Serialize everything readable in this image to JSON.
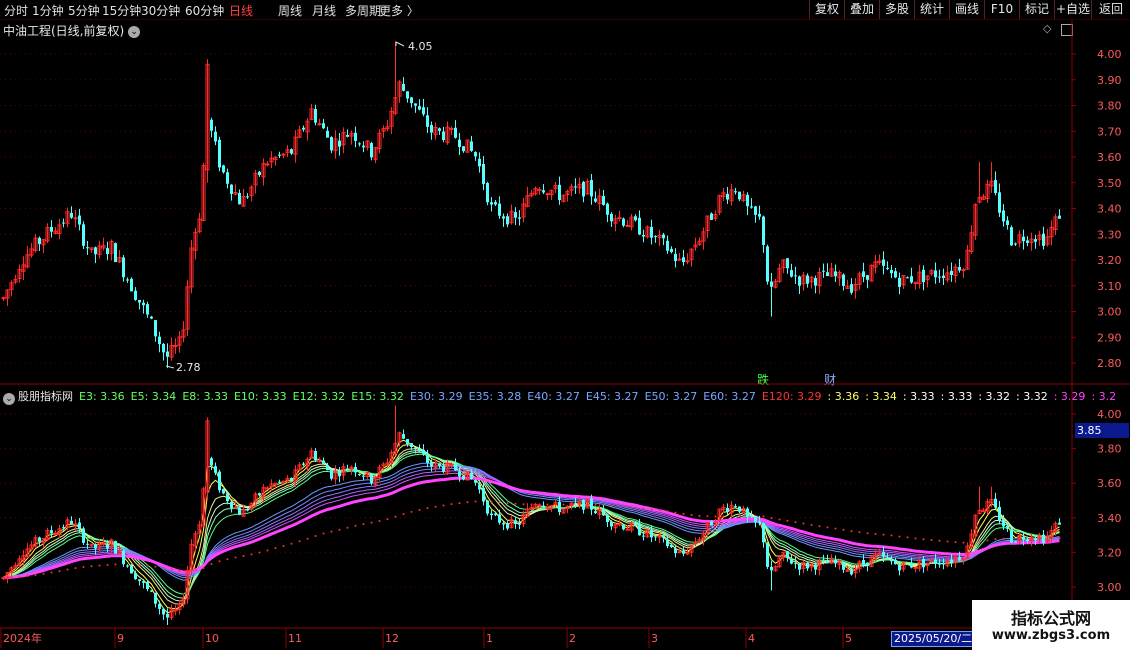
{
  "toolbar": {
    "periods": [
      "分时",
      "1分钟",
      "5分钟",
      "15分钟",
      "30分钟",
      "60分钟",
      "日线",
      "周线",
      "月线",
      "多周期",
      "更多 〉"
    ],
    "active_period": "日线",
    "right_buttons": [
      "复权",
      "叠加",
      "多股",
      "统计",
      "画线",
      "F10",
      "标记",
      "+自选",
      "返回"
    ]
  },
  "main_chart": {
    "title": "中油工程(日线,前复权)",
    "y_ticks": [
      "4.00",
      "3.90",
      "3.80",
      "3.70",
      "3.60",
      "3.50",
      "3.40",
      "3.30",
      "3.20",
      "3.10",
      "3.00",
      "2.90",
      "2.80"
    ],
    "high_label": "4.05",
    "low_label": "2.78"
  },
  "indicator": {
    "name": "股朋指标网",
    "legend": [
      {
        "text": "E3: 3.36",
        "color": "#66ff66"
      },
      {
        "text": "E5: 3.34",
        "color": "#66ff66"
      },
      {
        "text": "E8: 3.33",
        "color": "#66ff66"
      },
      {
        "text": "E10: 3.33",
        "color": "#66ff66"
      },
      {
        "text": "E12: 3.32",
        "color": "#66ff66"
      },
      {
        "text": "E15: 3.32",
        "color": "#66ff66"
      },
      {
        "text": "E30: 3.29",
        "color": "#7aa6ff"
      },
      {
        "text": "E35: 3.28",
        "color": "#7aa6ff"
      },
      {
        "text": "E40: 3.27",
        "color": "#7aa6ff"
      },
      {
        "text": "E45: 3.27",
        "color": "#7aa6ff"
      },
      {
        "text": "E50: 3.27",
        "color": "#7aa6ff"
      },
      {
        "text": "E60: 3.27",
        "color": "#7aa6ff"
      },
      {
        "text": "E120: 3.29",
        "color": "#ff3030"
      },
      {
        "text": ": 3.36",
        "color": "#ffff66"
      },
      {
        "text": ": 3.34",
        "color": "#ffff66"
      },
      {
        "text": ": 3.33",
        "color": "#ffffff"
      },
      {
        "text": ": 3.33",
        "color": "#ffffff"
      },
      {
        "text": ": 3.32",
        "color": "#ffffff"
      },
      {
        "text": ": 3.32",
        "color": "#ffffff"
      },
      {
        "text": ": 3.29",
        "color": "#ff44ff"
      },
      {
        "text": ": 3.2",
        "color": "#ff44ff"
      }
    ],
    "y_ticks": [
      "4.00",
      "3.80",
      "3.60",
      "3.40",
      "3.20",
      "3.00"
    ],
    "current_price": "3.85",
    "signals": [
      {
        "text": "跌",
        "color": "#44ff44"
      },
      {
        "text": "财",
        "color": "#88aaff"
      }
    ]
  },
  "x_axis": {
    "labels": [
      "2024年",
      "9",
      "10",
      "11",
      "12",
      "1",
      "2",
      "3",
      "4",
      "5"
    ],
    "date_box": "2025/05/20/二"
  },
  "watermark": {
    "title": "指标公式网",
    "url": "www.zbgs3.com"
  },
  "colors": {
    "up": "#ff2a2a",
    "down": "#54ffff",
    "axis": "#8b0000",
    "grid": "#5a0000"
  }
}
